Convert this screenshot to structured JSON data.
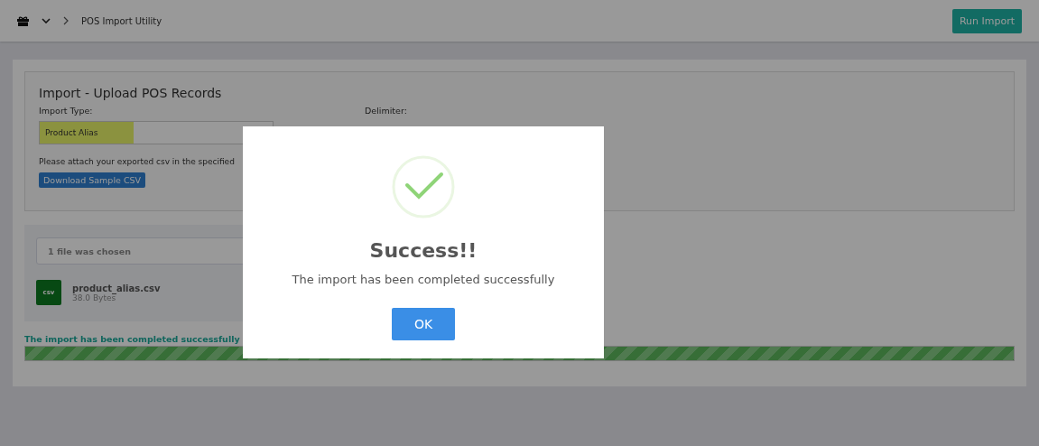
{
  "header": {
    "breadcrumb": "POS Import Utility",
    "run_button": "Run Import"
  },
  "upload": {
    "title": "Import - Upload POS Records",
    "import_type_label": "Import Type:",
    "import_type_value": "Product Alias",
    "delimiter_label": "Delimiter:",
    "hint": "Please attach your exported csv in the specified",
    "download_button": "Download Sample CSV"
  },
  "files": {
    "chosen": "1 file was chosen",
    "items": [
      {
        "badge": "csv",
        "name": "product_alias.csv",
        "size": "38.0 Bytes"
      }
    ]
  },
  "status": {
    "message": "The import has been completed successfully",
    "level": 1
  },
  "modal": {
    "title": "Success!!",
    "message": "The import has been completed successfully",
    "ok": "OK"
  }
}
